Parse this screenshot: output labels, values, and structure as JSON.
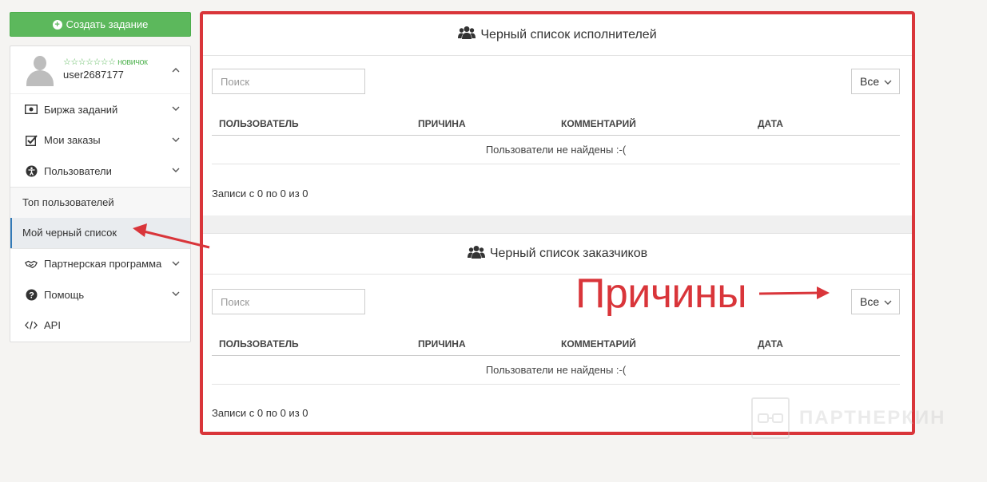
{
  "sidebar": {
    "create_button": "Создать задание",
    "profile": {
      "rank": "☆☆☆☆☆☆☆ новичок",
      "username": "user2687177"
    },
    "items": [
      {
        "label": "Биржа заданий",
        "icon": "cash-icon"
      },
      {
        "label": "Мои заказы",
        "icon": "checkbox-icon"
      },
      {
        "label": "Пользователи",
        "icon": "accessibility-icon"
      }
    ],
    "sub_items": [
      {
        "label": "Топ пользователей"
      },
      {
        "label": "Мой черный список"
      }
    ],
    "items_after": [
      {
        "label": "Партнерская программа",
        "icon": "handshake-icon"
      },
      {
        "label": "Помощь",
        "icon": "question-icon"
      },
      {
        "label": "API",
        "icon": "code-icon"
      }
    ]
  },
  "panels": [
    {
      "title": "Черный список исполнителей",
      "search_placeholder": "Поиск",
      "filter_value": "Все",
      "columns": [
        "ПОЛЬЗОВАТЕЛЬ",
        "ПРИЧИНА",
        "КОММЕНТАРИЙ",
        "ДАТА"
      ],
      "empty_text": "Пользователи не найдены :-(",
      "records_text": "Записи с 0 по 0 из 0"
    },
    {
      "title": "Черный список заказчиков",
      "search_placeholder": "Поиск",
      "filter_value": "Все",
      "columns": [
        "ПОЛЬЗОВАТЕЛЬ",
        "ПРИЧИНА",
        "КОММЕНТАРИЙ",
        "ДАТА"
      ],
      "empty_text": "Пользователи не найдены :-(",
      "records_text": "Записи с 0 по 0 из 0"
    }
  ],
  "annotation": {
    "text": "Причины"
  },
  "watermark": {
    "text": "ПАРТНЕРКИН"
  },
  "colors": {
    "accent_green": "#5cb85c",
    "annotation_red": "#d9353a",
    "active_border": "#337ab7"
  }
}
